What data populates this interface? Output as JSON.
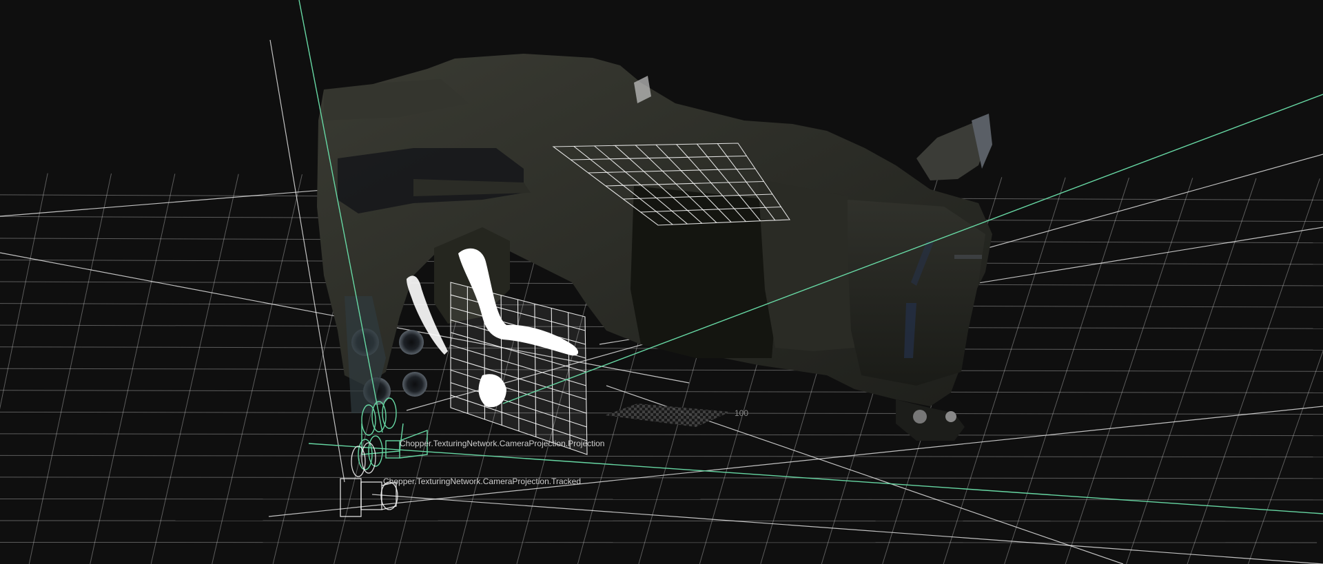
{
  "viewport": {
    "background_color": "#0f0f0f",
    "grid_color": "#ffffff",
    "axis_color": "#67d8a4",
    "grid_tick_label": "100",
    "cameras": [
      {
        "label": "Chopper.TexturingNetwork.CameraProjection.Projection"
      },
      {
        "label": "Chopper.TexturingNetwork.CameraProjection.Tracked"
      }
    ]
  }
}
